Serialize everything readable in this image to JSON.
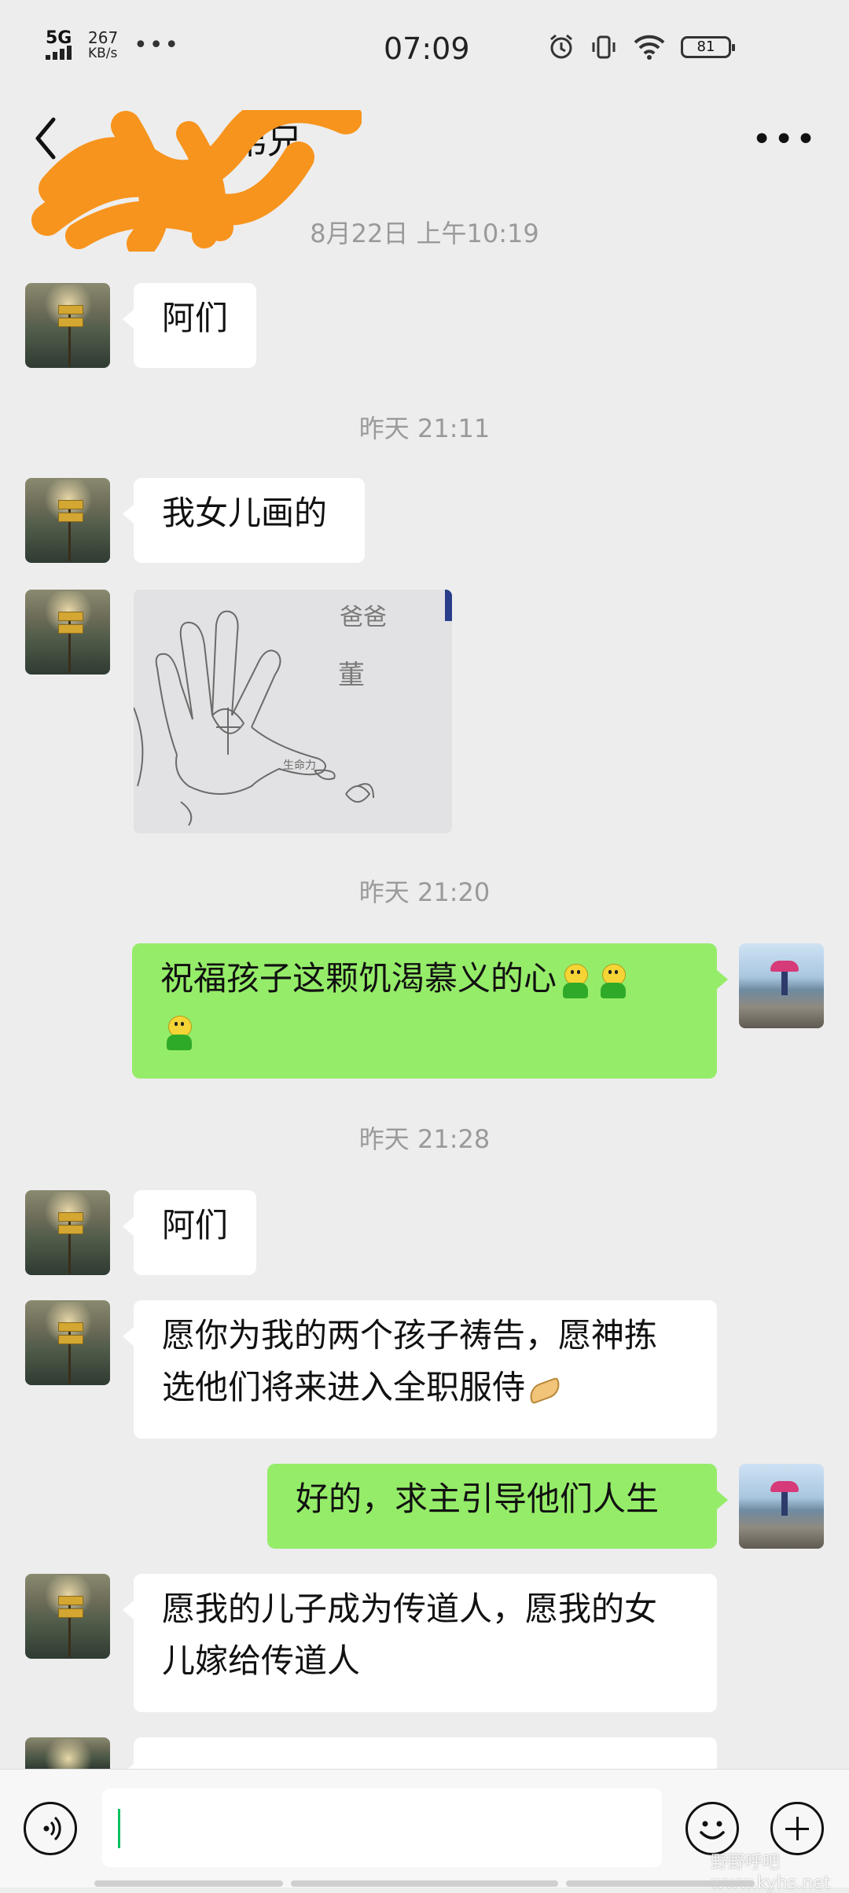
{
  "status_bar": {
    "network": "5G",
    "speed_value": "267",
    "speed_unit": "KB/s",
    "overflow": "•••",
    "time": "07:09",
    "battery": "81"
  },
  "header": {
    "title": "弟兄",
    "more": "•••"
  },
  "messages": [
    {
      "timestamp": "8月22日 上午10:19"
    },
    {
      "from": "other",
      "text": "阿们"
    },
    {
      "timestamp": "昨天 21:11"
    },
    {
      "from": "other",
      "text": "我女儿画的"
    },
    {
      "from": "other",
      "image": "hand-drawing"
    },
    {
      "timestamp": "昨天 21:20"
    },
    {
      "from": "me",
      "text": "祝福孩子这颗饥渴慕义的心"
    },
    {
      "timestamp": "昨天 21:28"
    },
    {
      "from": "other",
      "text": "阿们"
    },
    {
      "from": "other",
      "text": "愿你为我的两个孩子祷告，愿神拣选他们将来进入全职服侍"
    },
    {
      "from": "me",
      "text": "好的，求主引导他们人生"
    },
    {
      "from": "other",
      "text": "愿我的儿子成为传道人，愿我的女儿嫁给传道人"
    }
  ],
  "drawing_text": {
    "label_1": "爸爸",
    "label_2": "董",
    "label_3": "生命力"
  },
  "input_bar": {
    "watermark": "野野呼吧 www.kyhs.net"
  },
  "colors": {
    "background": "#ededed",
    "my_bubble": "#95ec69",
    "other_bubble": "#ffffff",
    "timestamp": "#9a9a9a",
    "scribble": "#f7941d"
  }
}
